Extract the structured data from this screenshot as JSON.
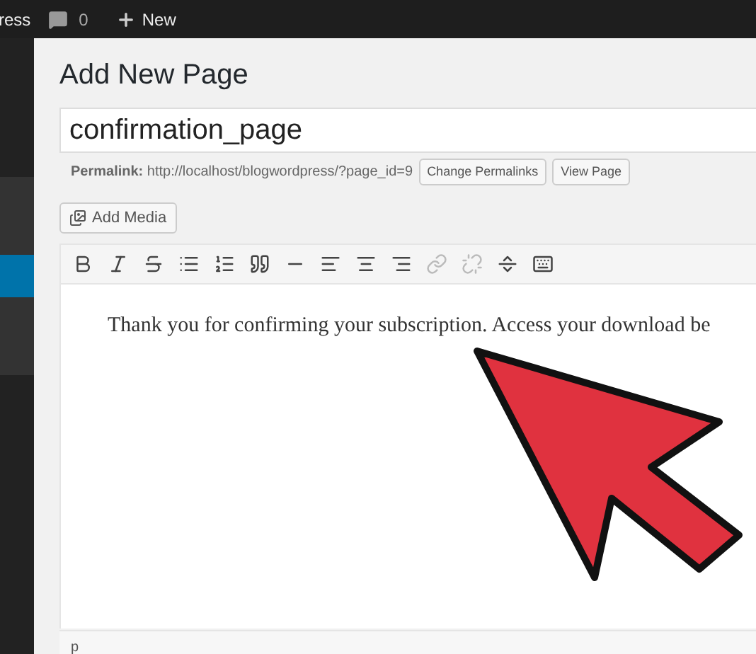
{
  "admin_bar": {
    "site_name": "ress",
    "comments_count": "0",
    "new_label": "New"
  },
  "sidebar": {
    "items": [
      {
        "selected": false
      },
      {
        "selected": true
      },
      {
        "selected": false
      }
    ]
  },
  "page": {
    "heading": "Add New Page",
    "title_field": {
      "value": "confirmation_page"
    },
    "permalink": {
      "label": "Permalink:",
      "url": "http://localhost/blogwordpress/?page_id=9",
      "buttons": [
        "Change Permalinks",
        "View Page"
      ]
    },
    "add_media": "Add Media",
    "toolbar": [
      {
        "kind": "bold",
        "disabled": false
      },
      {
        "kind": "italic",
        "disabled": false
      },
      {
        "kind": "strike",
        "disabled": false
      },
      {
        "kind": "bullets",
        "disabled": false
      },
      {
        "kind": "numbers",
        "disabled": false
      },
      {
        "kind": "quote",
        "disabled": false
      },
      {
        "kind": "rule",
        "disabled": false
      },
      {
        "kind": "left",
        "disabled": false
      },
      {
        "kind": "center",
        "disabled": false
      },
      {
        "kind": "right",
        "disabled": false
      },
      {
        "kind": "link",
        "disabled": true
      },
      {
        "kind": "unlink",
        "disabled": true
      },
      {
        "kind": "more",
        "disabled": false
      },
      {
        "kind": "kitchen",
        "disabled": false
      }
    ],
    "editor_text": "Thank you for confirming your subscription. Access your download be",
    "path": "p"
  }
}
